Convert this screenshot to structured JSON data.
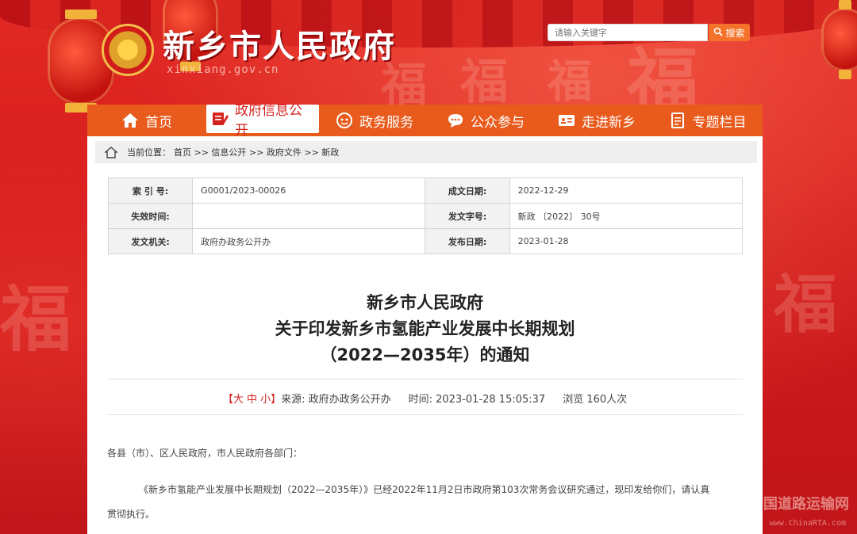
{
  "header": {
    "site_title": "新乡市人民政府",
    "site_subtitle": "xinxiang.gov.cn",
    "search_placeholder": "请输入关键字",
    "search_button": "搜索"
  },
  "nav": {
    "items": [
      {
        "label": "首页",
        "icon": "home-icon"
      },
      {
        "label": "政府信息公开",
        "icon": "document-edit-icon",
        "active": true
      },
      {
        "label": "政务服务",
        "icon": "service-icon"
      },
      {
        "label": "公众参与",
        "icon": "chat-icon"
      },
      {
        "label": "走进新乡",
        "icon": "id-card-icon"
      },
      {
        "label": "专题栏目",
        "icon": "topic-icon"
      }
    ]
  },
  "breadcrumb": {
    "prefix": "当前位置：",
    "path": "首页 >> 信息公开 >> 政府文件 >> 新政"
  },
  "info_table": {
    "rows": [
      [
        {
          "label": "索 引 号:",
          "value": "G0001/2023-00026"
        },
        {
          "label": "成文日期:",
          "value": "2022-12-29"
        }
      ],
      [
        {
          "label": "失效时间:",
          "value": ""
        },
        {
          "label": "发文字号:",
          "value": "新政 〔2022〕 30号"
        }
      ],
      [
        {
          "label": "发文机关:",
          "value": "政府办政务公开办"
        },
        {
          "label": "发布日期:",
          "value": "2023-01-28"
        }
      ]
    ]
  },
  "document": {
    "title_line1": "新乡市人民政府",
    "title_line2": "关于印发新乡市氢能产业发展中长期规划",
    "title_line3": "（2022—2035年）的通知",
    "font_size_control": "【大 中 小】",
    "source": "来源:   政府办政务公开办",
    "time": "时间:   2023-01-28 15:05:37",
    "views": "浏览 160人次",
    "salutation": "各县（市）、区人民政府，市人民政府各部门：",
    "para1_line1": "《新乡市氢能产业发展中长期规划（2022—2035年）》已经2022年11月2日市政府第103次常务会议研究通过，现印发给你们，请认真",
    "para1_line2": "贯彻执行。"
  },
  "watermark": {
    "main": "国道路运输网",
    "sub": "www.ChinaRTA.com"
  },
  "colors": {
    "nav_bg": "#e85b1d",
    "accent_red": "#d4231e",
    "search_button": "#f4722a"
  }
}
